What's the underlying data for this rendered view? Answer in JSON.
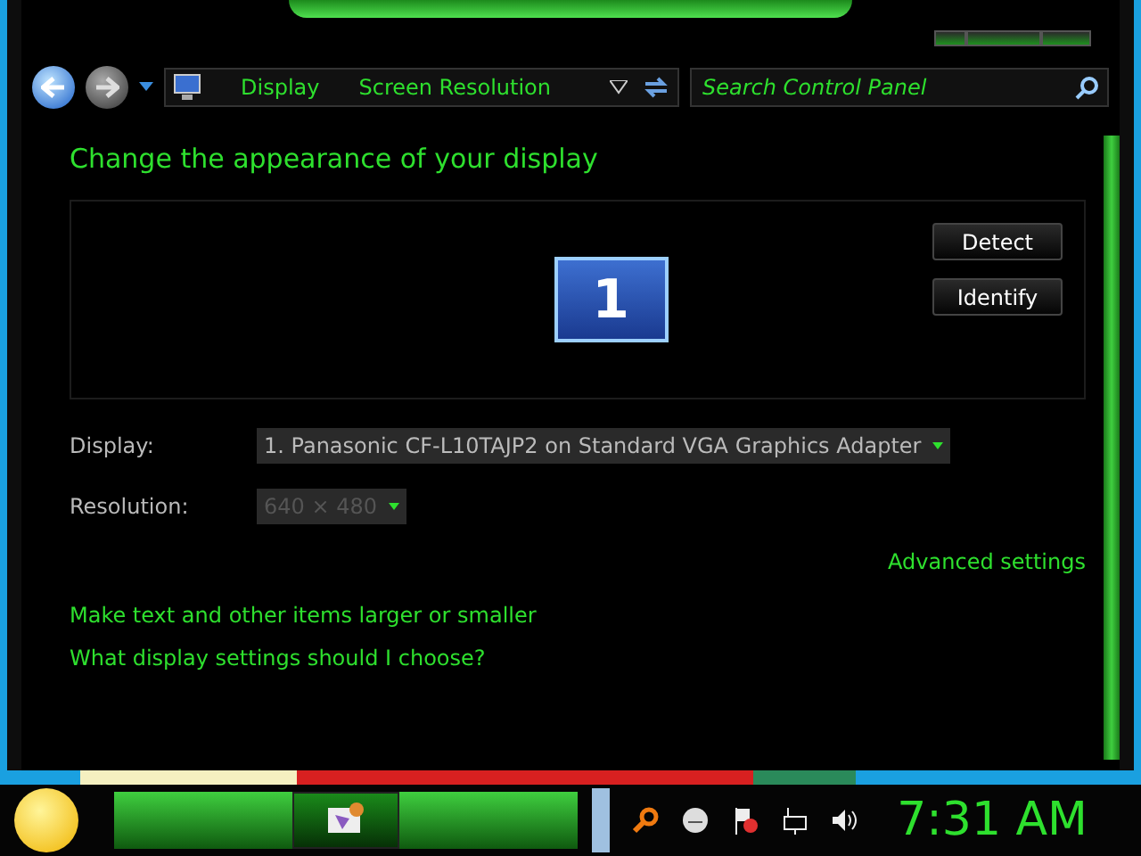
{
  "address_bar": {
    "breadcrumbs": [
      "Display",
      "Screen Resolution"
    ]
  },
  "search": {
    "placeholder": "Search Control Panel"
  },
  "heading": "Change the appearance of your display",
  "monitors": [
    {
      "label": "1",
      "selected": true
    }
  ],
  "preview_buttons": [
    "Detect",
    "Identify"
  ],
  "settings": [
    {
      "label": "Display:",
      "value": "1. Panasonic CF-L10TAJP2 on Standard VGA Graphics Adapter",
      "disabled": false
    },
    {
      "label": "Resolution:",
      "value": "640 × 480",
      "disabled": true
    }
  ],
  "advanced_link": "Advanced settings",
  "links": [
    "Make text and other items larger or smaller",
    "What display settings should I choose?"
  ],
  "taskbar": {
    "clock": "7:31 AM"
  }
}
